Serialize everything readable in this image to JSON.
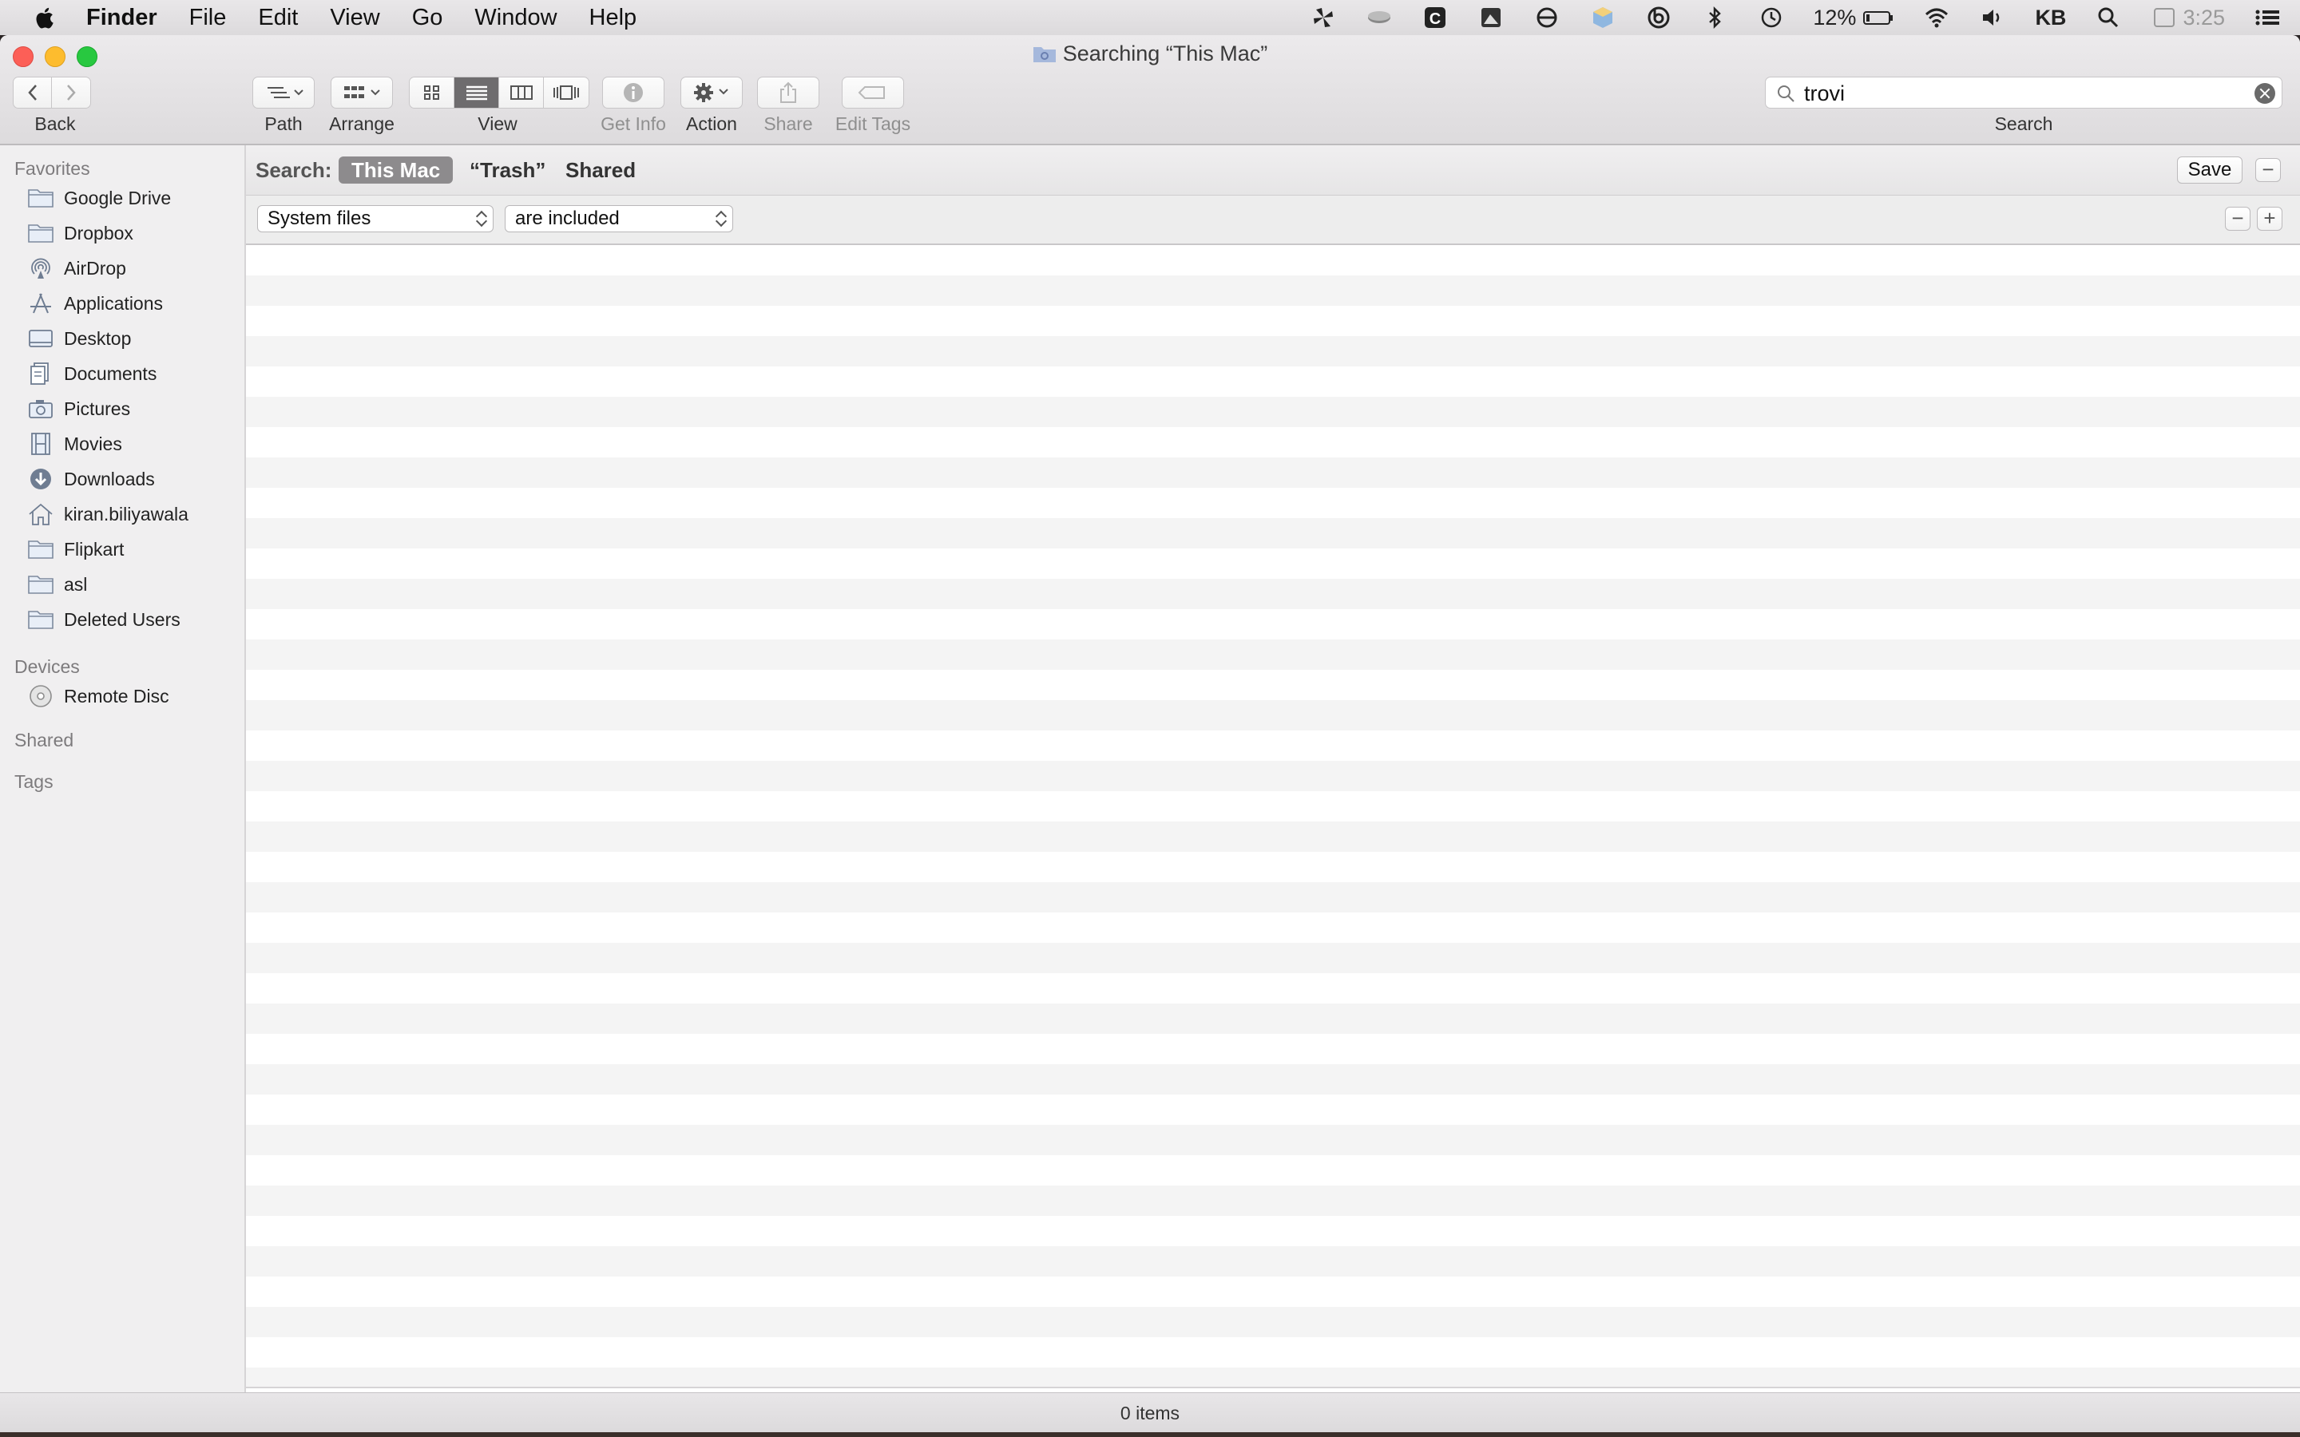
{
  "menubar": {
    "app_name": "Finder",
    "items": [
      "File",
      "Edit",
      "View",
      "Go",
      "Window",
      "Help"
    ],
    "battery_percent": "12%",
    "user_initials": "KB",
    "clock": "3:25"
  },
  "window": {
    "title": "Searching “This Mac”"
  },
  "toolbar": {
    "back_label": "Back",
    "path_label": "Path",
    "arrange_label": "Arrange",
    "view_label": "View",
    "get_info_label": "Get Info",
    "action_label": "Action",
    "share_label": "Share",
    "edit_tags_label": "Edit Tags",
    "search_label": "Search",
    "search_value": "trovi",
    "active_view": "list"
  },
  "sidebar": {
    "favorites_header": "Favorites",
    "favorites": [
      {
        "label": "Google Drive",
        "icon": "folder-icon"
      },
      {
        "label": "Dropbox",
        "icon": "folder-icon"
      },
      {
        "label": "AirDrop",
        "icon": "airdrop-icon"
      },
      {
        "label": "Applications",
        "icon": "applications-icon"
      },
      {
        "label": "Desktop",
        "icon": "desktop-icon"
      },
      {
        "label": "Documents",
        "icon": "documents-icon"
      },
      {
        "label": "Pictures",
        "icon": "camera-icon"
      },
      {
        "label": "Movies",
        "icon": "film-icon"
      },
      {
        "label": "Downloads",
        "icon": "download-icon"
      },
      {
        "label": "kiran.biliyawala",
        "icon": "home-icon"
      },
      {
        "label": "Flipkart",
        "icon": "folder-icon"
      },
      {
        "label": "asl",
        "icon": "folder-icon"
      },
      {
        "label": "Deleted Users",
        "icon": "folder-icon"
      }
    ],
    "devices_header": "Devices",
    "devices": [
      {
        "label": "Remote Disc",
        "icon": "disc-icon"
      }
    ],
    "shared_header": "Shared",
    "tags_header": "Tags"
  },
  "search_scope": {
    "label": "Search:",
    "options": [
      "This Mac",
      "“Trash”",
      "Shared"
    ],
    "selected": "This Mac",
    "save_label": "Save"
  },
  "criteria": {
    "attribute": "System files",
    "condition": "are included"
  },
  "status": {
    "item_count": "0 items"
  },
  "colors": {
    "close": "#fc5f57",
    "minimize": "#fdbc2e",
    "zoom": "#28c840",
    "scope_selected": "#8d8b8d"
  }
}
